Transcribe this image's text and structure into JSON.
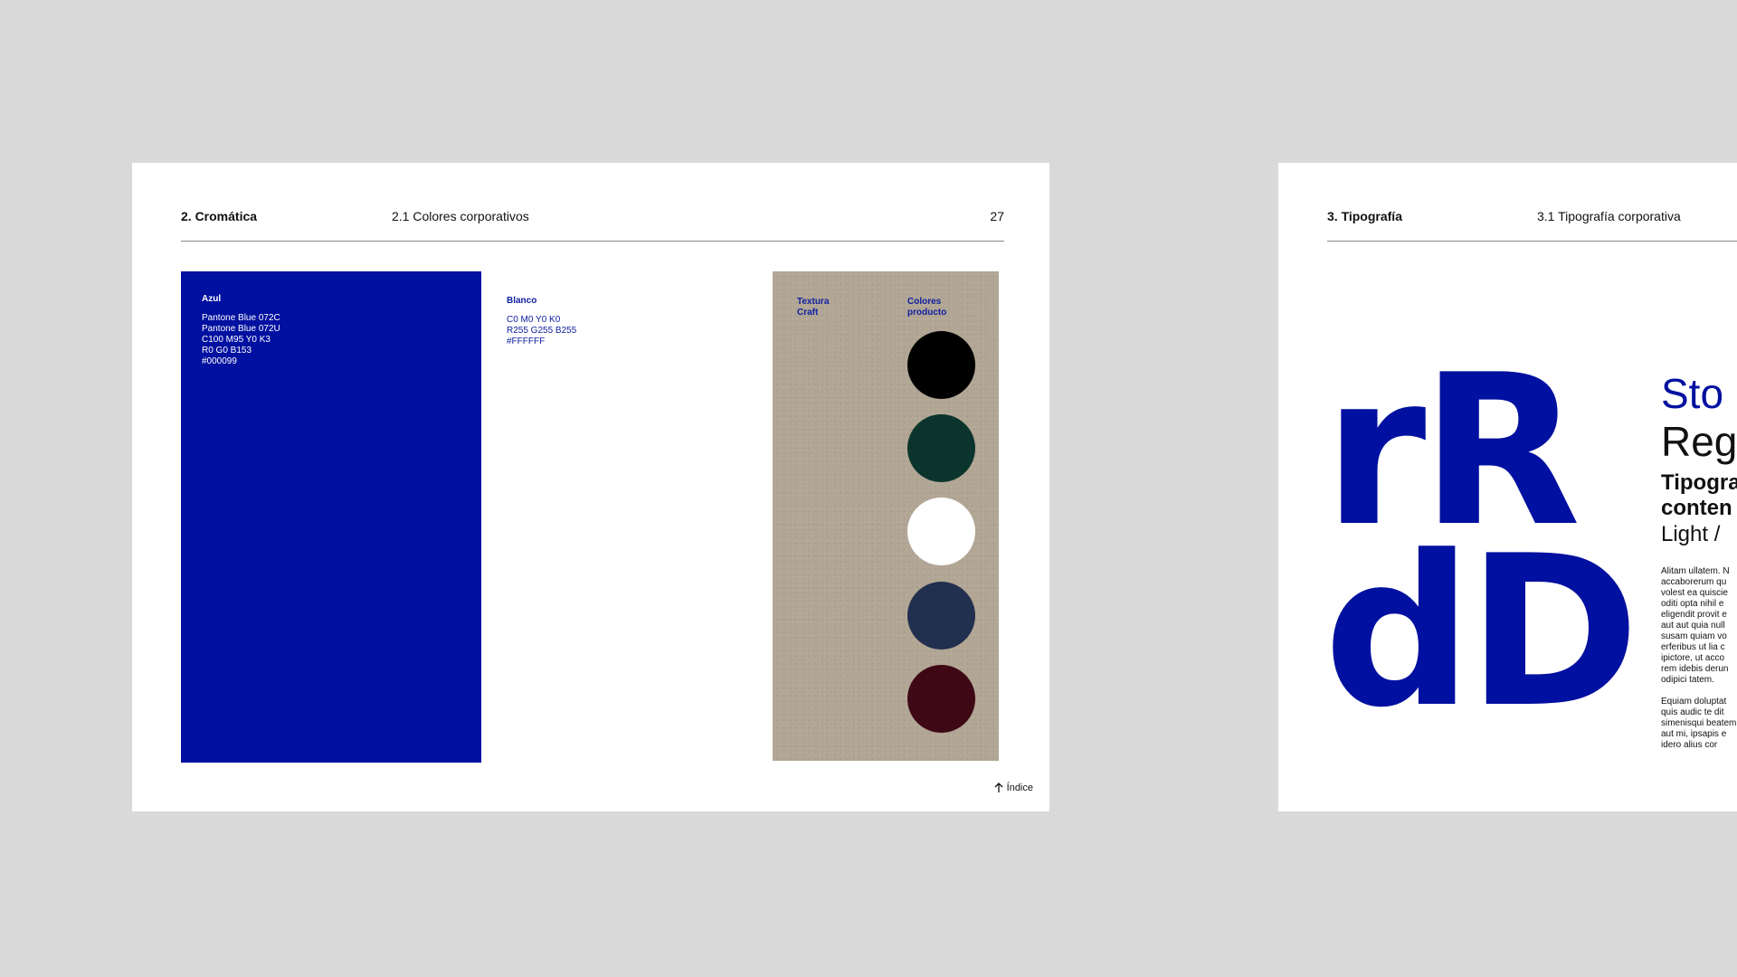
{
  "left_page": {
    "section": "2. Cromática",
    "subsection": "2.1 Colores corporativos",
    "page_number": "27",
    "blue_swatch": {
      "name": "Azul",
      "specs": [
        "Pantone Blue 072C",
        "Pantone Blue 072U",
        "C100 M95 Y0 K3",
        "R0 G0 B153",
        "#000099"
      ],
      "color": "#0010a0"
    },
    "white_swatch": {
      "name": "Blanco",
      "specs": [
        "C0 M0 Y0 K0",
        "R255 G255 B255",
        "#FFFFFF"
      ]
    },
    "craft": {
      "texture_label": [
        "Textura",
        "Craft"
      ],
      "product_label": [
        "Colores",
        "producto"
      ],
      "product_colors": [
        "#000000",
        "#0b352c",
        "#ffffff",
        "#22304f",
        "#3e0815"
      ]
    },
    "index_link": "Índice"
  },
  "right_page": {
    "section": "3. Tipografía",
    "subsection": "3.1 Tipografía corporativa",
    "letters_line1": "rR",
    "letters_line2": "dD",
    "type_title": "Sto",
    "type_regular": "Reg",
    "type_sub_1": "Tipogra",
    "type_sub_2": "conten",
    "type_light": "Light /",
    "body_para1": [
      "Alitam ullatem. N",
      "accaborerum qu",
      "volest ea quiscie",
      "oditi opta nihil e",
      "eligendit provit e",
      "aut aut quia null",
      "susam quiam vo",
      "erferibus ut lia c",
      "ipictore, ut acco",
      "rem idebis derun",
      "odipici tatem."
    ],
    "body_para2": [
      "Equiam doluptat",
      "quis audic te dit",
      "simenisqui beatem",
      "aut mi, ipsapis e",
      "idero alius cor"
    ]
  }
}
